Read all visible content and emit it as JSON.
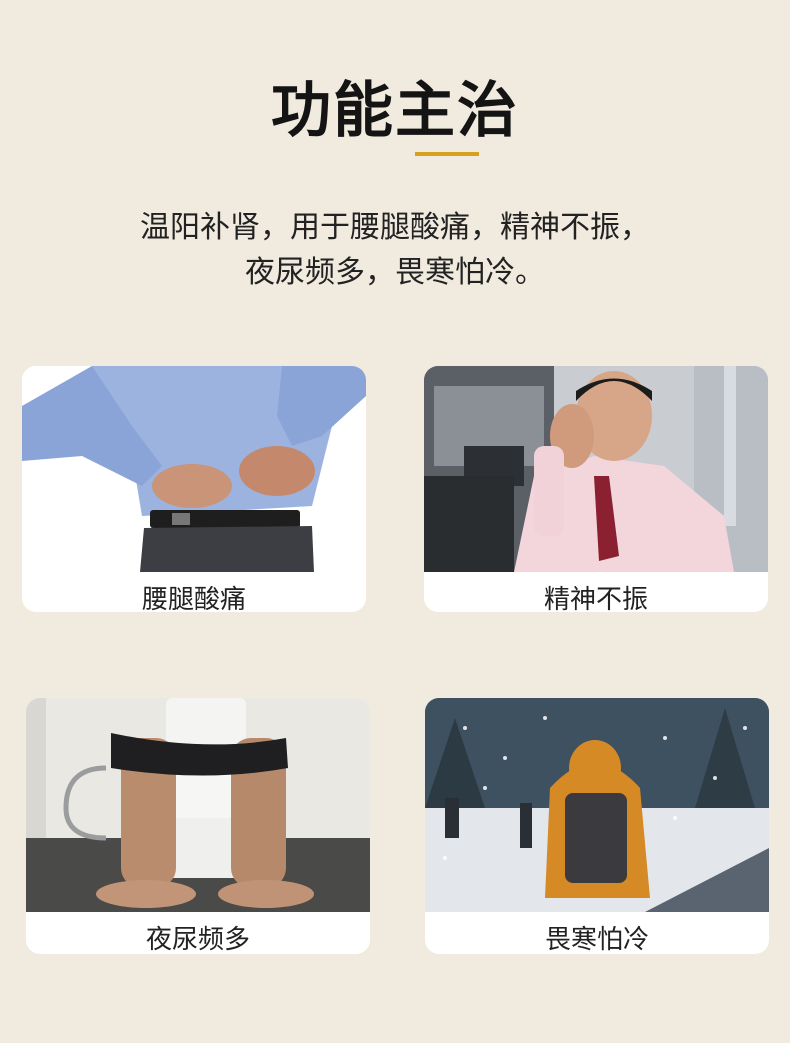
{
  "header": {
    "title": "功能主治",
    "desc_line1": "温阳补肾，用于腰腿酸痛，精神不振，",
    "desc_line2": "夜尿频多，畏寒怕冷。",
    "accent_color": "#d6a21e"
  },
  "cards": [
    {
      "label": "腰腿酸痛",
      "icon": "back-pain-photo"
    },
    {
      "label": "精神不振",
      "icon": "fatigue-photo"
    },
    {
      "label": "夜尿频多",
      "icon": "toilet-photo"
    },
    {
      "label": "畏寒怕冷",
      "icon": "snow-cold-photo"
    }
  ],
  "colors": {
    "background": "#f1ebdf",
    "card": "#ffffff",
    "text": "#222222"
  }
}
